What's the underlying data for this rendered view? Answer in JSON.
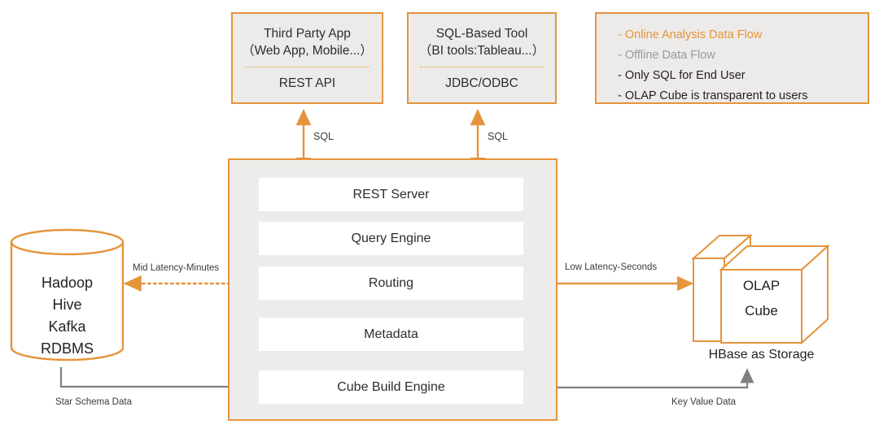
{
  "clients": [
    {
      "id": "third-party-app",
      "title_line1": "Third Party App",
      "title_line2": "（Web App, Mobile...）",
      "api": "REST API"
    },
    {
      "id": "sql-based-tool",
      "title_line1": "SQL-Based Tool",
      "title_line2": "（BI tools:Tableau...）",
      "api": "JDBC/ODBC"
    }
  ],
  "legend": {
    "items": [
      {
        "label": "- Online Analysis Data Flow",
        "style": "orange",
        "arrow": "double-orange"
      },
      {
        "label": "- Offline Data Flow",
        "style": "gray",
        "arrow": "double-gray"
      },
      {
        "label": "- Only SQL for End User",
        "style": "black",
        "arrow": "none"
      },
      {
        "label": "- OLAP Cube is transparent to users",
        "style": "black",
        "arrow": "none"
      }
    ]
  },
  "main_panel": {
    "layers": [
      "REST Server",
      "Query Engine",
      "Routing",
      "Metadata",
      "Cube Build Engine"
    ]
  },
  "source_store": {
    "lines": [
      "Hadoop",
      "Hive",
      "Kafka",
      "RDBMS"
    ]
  },
  "olap_storage": {
    "cube_line1": "OLAP",
    "cube_line2": "Cube",
    "caption": "HBase  as Storage"
  },
  "edge_labels": {
    "sql_left": "SQL",
    "sql_right": "SQL",
    "mid_latency": "Mid Latency-Minutes",
    "low_latency": "Low Latency-Seconds",
    "star_schema": "Star Schema Data",
    "key_value": "Key Value Data"
  },
  "colors": {
    "orange": "#E4943B",
    "gray": "#808080",
    "panel": "#EDECEA",
    "box_fill": "#EDEBE9",
    "white": "#FFFFFF",
    "text": "#231f20",
    "legend_gray_text": "#9a9a9a"
  }
}
